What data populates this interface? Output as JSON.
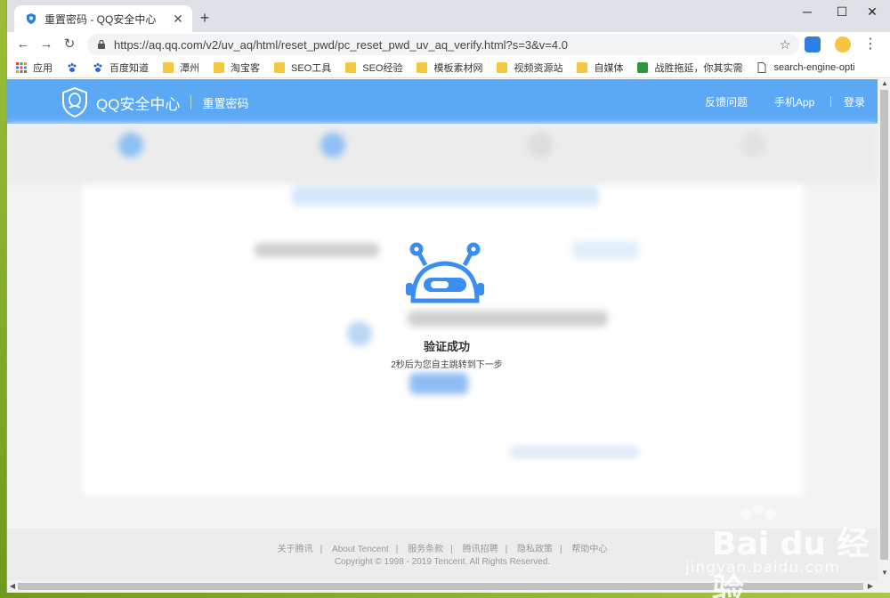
{
  "browser": {
    "tab_title": "重置密码 - QQ安全中心",
    "url": "https://aq.qq.com/v2/uv_aq/html/reset_pwd/pc_reset_pwd_uv_aq_verify.html?s=3&v=4.0",
    "icons": {
      "back": "back-arrow-icon",
      "forward": "forward-arrow-icon",
      "reload": "reload-icon",
      "lock": "lock-icon",
      "star": "star-icon",
      "menu": "kebab-menu-icon"
    }
  },
  "bookmarks": [
    {
      "label": "应用",
      "icon": "apps-grid-icon"
    },
    {
      "label": "",
      "icon": "baidu-paw-icon"
    },
    {
      "label": "百度知道",
      "icon": "baidu-paw-icon"
    },
    {
      "label": "潭州",
      "icon": "folder-icon"
    },
    {
      "label": "淘宝客",
      "icon": "folder-icon"
    },
    {
      "label": "SEO工具",
      "icon": "folder-icon"
    },
    {
      "label": "SEO经验",
      "icon": "folder-icon"
    },
    {
      "label": "模板素材网",
      "icon": "folder-icon"
    },
    {
      "label": "视频资源站",
      "icon": "folder-icon"
    },
    {
      "label": "自媒体",
      "icon": "folder-icon"
    },
    {
      "label": "战胜拖延，你其实需",
      "icon": "douban-icon"
    },
    {
      "label": "search-engine-opti",
      "icon": "page-icon"
    }
  ],
  "header": {
    "brand": "QQ安全中心",
    "section": "重置密码",
    "nav": [
      "反馈问题",
      "手机App",
      "登录"
    ]
  },
  "dialog": {
    "title": "验证成功",
    "subtitle": "2秒后为您自主跳转到下一步"
  },
  "footer": {
    "links": [
      "关于腾讯",
      "About Tencent",
      "服务条款",
      "腾讯招聘",
      "隐私政策",
      "帮助中心"
    ],
    "copyright": "Copyright © 1998 - 2019 Tencent. All Rights Reserved."
  },
  "watermark": {
    "logo": "Bai du 经验",
    "url": "jingyan.baidu.com"
  },
  "colors": {
    "header_blue": "#5ba8f5",
    "robot_blue": "#3b8ef0"
  }
}
